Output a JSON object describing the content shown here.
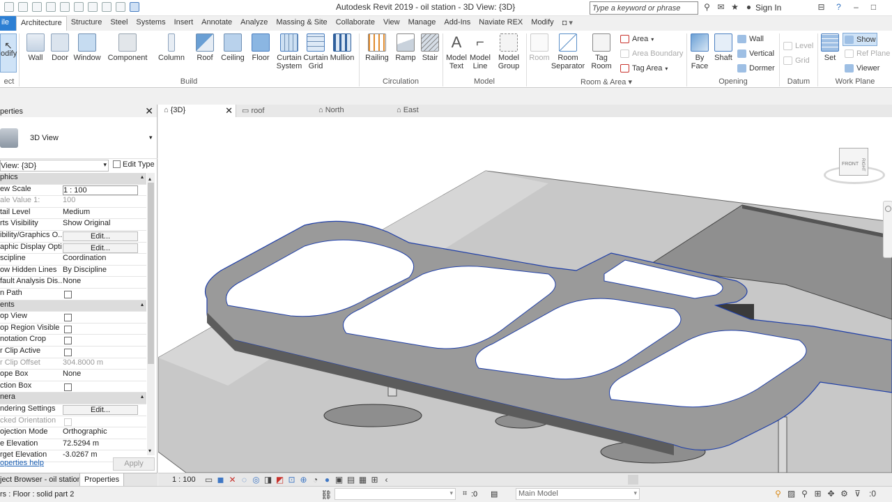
{
  "app": {
    "title": "Autodesk Revit 2019 - oil station - 3D View: {3D}",
    "search_placeholder": "Type a keyword or phrase",
    "sign_in": "Sign In"
  },
  "tabs": [
    "Architecture",
    "Structure",
    "Steel",
    "Systems",
    "Insert",
    "Annotate",
    "Analyze",
    "Massing & Site",
    "Collaborate",
    "View",
    "Manage",
    "Add-Ins",
    "Naviate REX",
    "Modify"
  ],
  "file_tab": "ile",
  "ribbon": {
    "modify": "odify",
    "select": "ect",
    "build": {
      "label": "Build",
      "buttons": [
        "Wall",
        "Door",
        "Window",
        "Component",
        "Column",
        "Roof",
        "Ceiling",
        "Floor",
        "Curtain System",
        "Curtain Grid",
        "Mullion"
      ]
    },
    "circulation": {
      "label": "Circulation",
      "buttons": [
        "Railing",
        "Ramp",
        "Stair"
      ]
    },
    "model": {
      "label": "Model",
      "buttons": [
        "Model Text",
        "Model Line",
        "Model Group"
      ]
    },
    "room_area": {
      "label": "Room & Area",
      "buttons": [
        "Room",
        "Room Separator",
        "Tag Room"
      ],
      "small": [
        "Area",
        "Area Boundary",
        "Tag Area"
      ]
    },
    "opening": {
      "label": "Opening",
      "buttons": [
        "By Face",
        "Shaft"
      ],
      "small": [
        "Wall",
        "Vertical",
        "Dormer"
      ]
    },
    "datum": {
      "label": "Datum",
      "small": [
        "Level",
        "Grid"
      ]
    },
    "workplane": {
      "label": "Work Plane",
      "buttons": [
        "Set"
      ],
      "small": [
        "Show",
        "Ref Plane",
        "Viewer"
      ]
    }
  },
  "properties": {
    "title": "perties",
    "type_name": "3D View",
    "selector": "View: {3D}",
    "edit_type": "Edit Type",
    "rows": [
      {
        "type": "sect",
        "k": "phics"
      },
      {
        "k": "ew Scale",
        "v": "1 : 100",
        "input": true
      },
      {
        "k": "ale Value   1:",
        "v": "100",
        "dis": true
      },
      {
        "k": "tail Level",
        "v": "Medium"
      },
      {
        "k": "rts Visibility",
        "v": "Show Original"
      },
      {
        "k": "ibility/Graphics O...",
        "btn": "Edit..."
      },
      {
        "k": "aphic Display Opti...",
        "btn": "Edit..."
      },
      {
        "k": "scipline",
        "v": "Coordination"
      },
      {
        "k": "ow Hidden Lines",
        "v": "By Discipline"
      },
      {
        "k": "fault Analysis Dis...",
        "v": "None"
      },
      {
        "k": "n Path",
        "cb": true
      },
      {
        "type": "sect",
        "k": "ents"
      },
      {
        "k": "op View",
        "cb": true
      },
      {
        "k": "op Region Visible",
        "cb": true
      },
      {
        "k": "notation Crop",
        "cb": true
      },
      {
        "k": "r Clip Active",
        "cb": true
      },
      {
        "k": "r Clip Offset",
        "v": "304.8000 m",
        "dis": true
      },
      {
        "k": "ope Box",
        "v": "None"
      },
      {
        "k": "ction Box",
        "cb": true
      },
      {
        "type": "sect",
        "k": "nera"
      },
      {
        "k": "ndering Settings",
        "btn": "Edit..."
      },
      {
        "k": "cked Orientation",
        "cb": true,
        "dis": true
      },
      {
        "k": "ojection Mode",
        "v": "Orthographic"
      },
      {
        "k": "e Elevation",
        "v": "72.5294 m"
      },
      {
        "k": "rget Elevation",
        "v": "-3.0267 m"
      }
    ],
    "help": "operties help",
    "apply": "Apply",
    "bottom_tabs": [
      "ject Browser - oil station",
      "Properties"
    ]
  },
  "view_tabs": [
    "{3D}",
    "roof",
    "North",
    "East"
  ],
  "viewcube": {
    "front": "FRONT",
    "right": "RIGHT"
  },
  "viewbar": {
    "scale": "1 : 100"
  },
  "status": {
    "text": "rs : Floor : solid part 2",
    "model": "Main Model",
    "zero": ":0"
  }
}
